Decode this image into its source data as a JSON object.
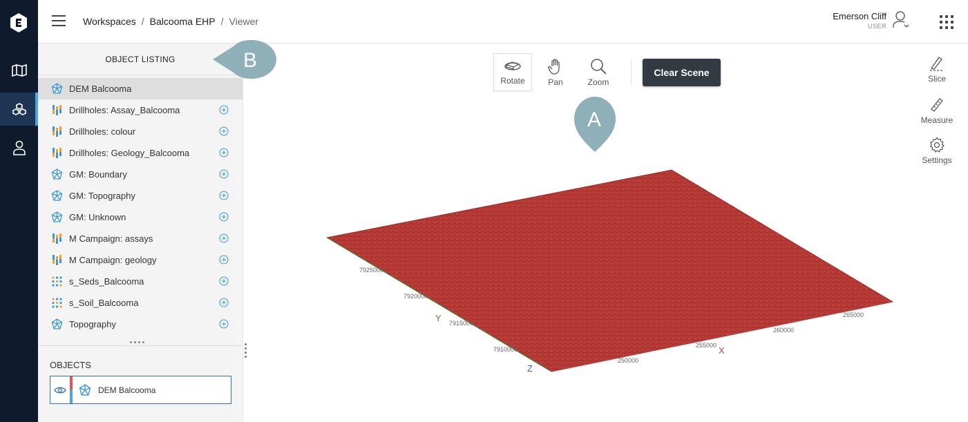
{
  "breadcrumb": {
    "items": [
      "Workspaces",
      "Balcooma EHP"
    ],
    "current": "Viewer",
    "separator": "/"
  },
  "user": {
    "name": "Emerson Cliff",
    "role": "USER"
  },
  "sidebar": {
    "listing_title": "OBJECT LISTING",
    "items": [
      {
        "label": "DEM Balcooma",
        "icon": "mesh-icon",
        "selected": true,
        "addable": false
      },
      {
        "label": "Drillholes: Assay_Balcooma",
        "icon": "drillhole-icon",
        "addable": true
      },
      {
        "label": "Drillholes: colour",
        "icon": "drillhole-icon",
        "addable": true
      },
      {
        "label": "Drillholes: Geology_Balcooma",
        "icon": "drillhole-icon",
        "addable": true
      },
      {
        "label": "GM: Boundary",
        "icon": "mesh-icon",
        "addable": true
      },
      {
        "label": "GM: Topography",
        "icon": "mesh-icon",
        "addable": true
      },
      {
        "label": "GM: Unknown",
        "icon": "mesh-icon",
        "addable": true
      },
      {
        "label": "M Campaign: assays",
        "icon": "drillhole-icon",
        "addable": true
      },
      {
        "label": "M Campaign: geology",
        "icon": "drillhole-icon",
        "addable": true
      },
      {
        "label": "s_Seds_Balcooma",
        "icon": "points-icon",
        "addable": true
      },
      {
        "label": "s_Soil_Balcooma",
        "icon": "points-icon",
        "addable": true
      },
      {
        "label": "Topography",
        "icon": "mesh-icon",
        "addable": true
      }
    ],
    "objects_title": "OBJECTS",
    "objects": [
      {
        "label": "DEM Balcooma",
        "icon": "mesh-icon",
        "visible": true
      }
    ]
  },
  "toolbar": {
    "rotate": "Rotate",
    "pan": "Pan",
    "zoom": "Zoom",
    "clear_scene": "Clear Scene",
    "active": "rotate"
  },
  "side_tools": {
    "slice": "Slice",
    "measure": "Measure",
    "settings": "Settings"
  },
  "scene": {
    "callouts": {
      "a": "A",
      "b": "B"
    },
    "axes": {
      "x_label": "X",
      "y_label": "Y",
      "z_label": "Z",
      "x_ticks": [
        "250000",
        "255000",
        "260000",
        "265000"
      ],
      "y_ticks": [
        "7910000",
        "7915000",
        "7920000",
        "7925000"
      ]
    },
    "surface_color": "#b73a36"
  },
  "colors": {
    "rail_bg": "#0f1b2d",
    "accent": "#4ba3e8",
    "callout": "#8fb0b9"
  }
}
